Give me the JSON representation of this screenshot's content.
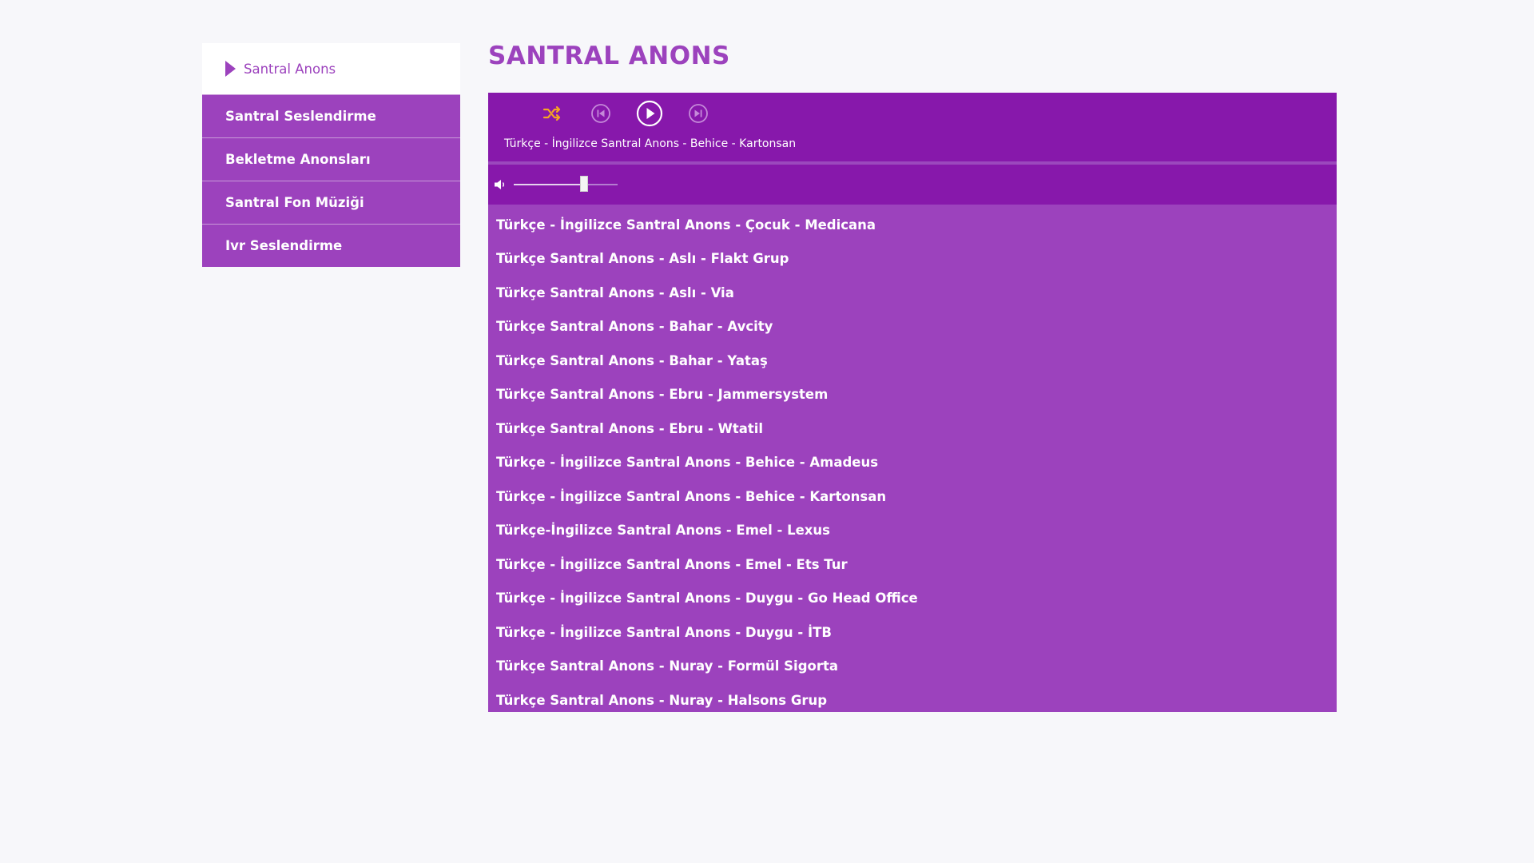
{
  "sidebar": {
    "items": [
      {
        "label": "Santral Anons",
        "active": true
      },
      {
        "label": "Santral Seslendirme",
        "active": false
      },
      {
        "label": "Bekletme Anonsları",
        "active": false
      },
      {
        "label": "Santral Fon Müziği",
        "active": false
      },
      {
        "label": "Ivr Seslendirme",
        "active": false
      }
    ]
  },
  "main": {
    "title": "SANTRAL ANONS"
  },
  "player": {
    "now_playing": "Türkçe - İngilizce Santral Anons - Behice - Kartonsan",
    "volume_fraction": 0.68,
    "icons": {
      "shuffle": "shuffle-icon",
      "previous": "previous-icon",
      "play": "play-icon",
      "next": "next-icon",
      "volume": "volume-icon"
    },
    "colors": {
      "shuffle_active": "#f5a623",
      "accent": "#9c42bd",
      "controls_bg": "#8718ab"
    },
    "playlist": [
      "Türkçe - İngilizce Santral Anons - Çocuk - Medicana",
      "Türkçe Santral Anons - Aslı - Flakt Grup",
      "Türkçe Santral Anons - Aslı - Via",
      "Türkçe Santral Anons - Bahar - Avcity",
      "Türkçe Santral Anons - Bahar - Yataş",
      "Türkçe Santral Anons - Ebru - Jammersystem",
      "Türkçe Santral Anons - Ebru - Wtatil",
      "Türkçe - İngilizce Santral Anons - Behice - Amadeus",
      "Türkçe - İngilizce Santral Anons - Behice - Kartonsan",
      "Türkçe-İngilizce Santral Anons - Emel - Lexus",
      "Türkçe - İngilizce Santral Anons - Emel - Ets Tur",
      "Türkçe - İngilizce Santral Anons - Duygu - Go Head Office",
      "Türkçe - İngilizce Santral Anons - Duygu - İTB",
      "Türkçe Santral Anons - Nuray - Formül Sigorta",
      "Türkçe Santral Anons - Nuray - Halsons Grup"
    ]
  }
}
